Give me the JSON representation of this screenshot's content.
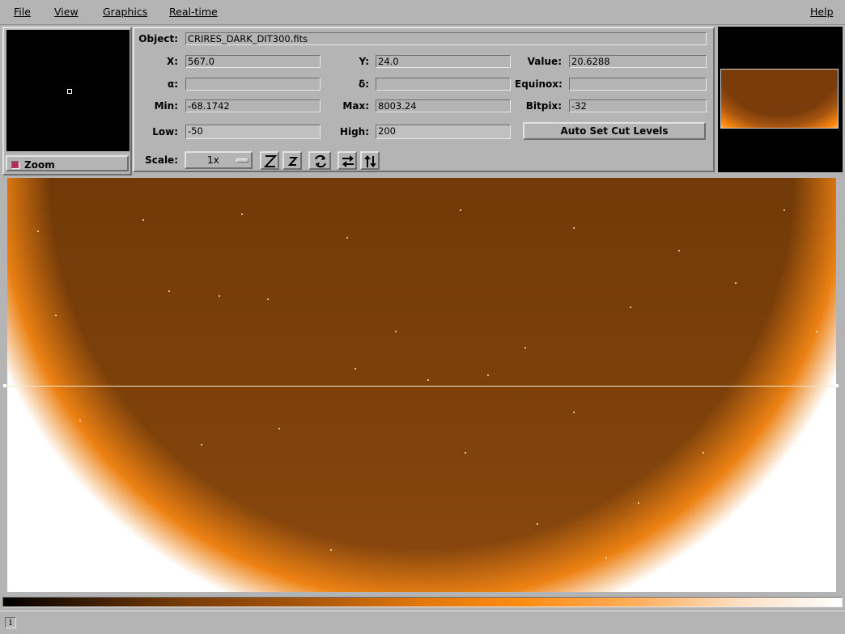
{
  "menu": {
    "file": "File",
    "view": "View",
    "graphics": "Graphics",
    "realtime": "Real-time",
    "help": "Help"
  },
  "zoom": {
    "label": "Zoom",
    "checked": true
  },
  "info": {
    "object_label": "Object:",
    "object_value": "CRIRES_DARK_DIT300.fits",
    "x_label": "X:",
    "x_value": "567.0",
    "y_label": "Y:",
    "y_value": "24.0",
    "value_label": "Value:",
    "value_value": "20.6288",
    "ra_label": "α:",
    "ra_value": "",
    "dec_label": "δ:",
    "dec_value": "",
    "equinox_label": "Equinox:",
    "equinox_value": "",
    "min_label": "Min:",
    "min_value": "-68.1742",
    "max_label": "Max:",
    "max_value": "8003.24",
    "bitpix_label": "Bitpix:",
    "bitpix_value": "-32",
    "low_label": "Low:",
    "low_value": "-50",
    "high_label": "High:",
    "high_value": "200",
    "auto_cut_button": "Auto Set Cut Levels",
    "scale_label": "Scale:",
    "scale_value": "1x"
  },
  "toolbar_icons": [
    "zoom-in-icon",
    "zoom-out-icon",
    "rotate-icon",
    "flip-x-icon",
    "flip-y-icon"
  ],
  "colors": {
    "background": "#b4b4b4",
    "image_base": "#7a3c08",
    "image_edge": "#ff8c14",
    "accent_check": "#b03060"
  },
  "status": {
    "icon": "i",
    "text": ""
  }
}
